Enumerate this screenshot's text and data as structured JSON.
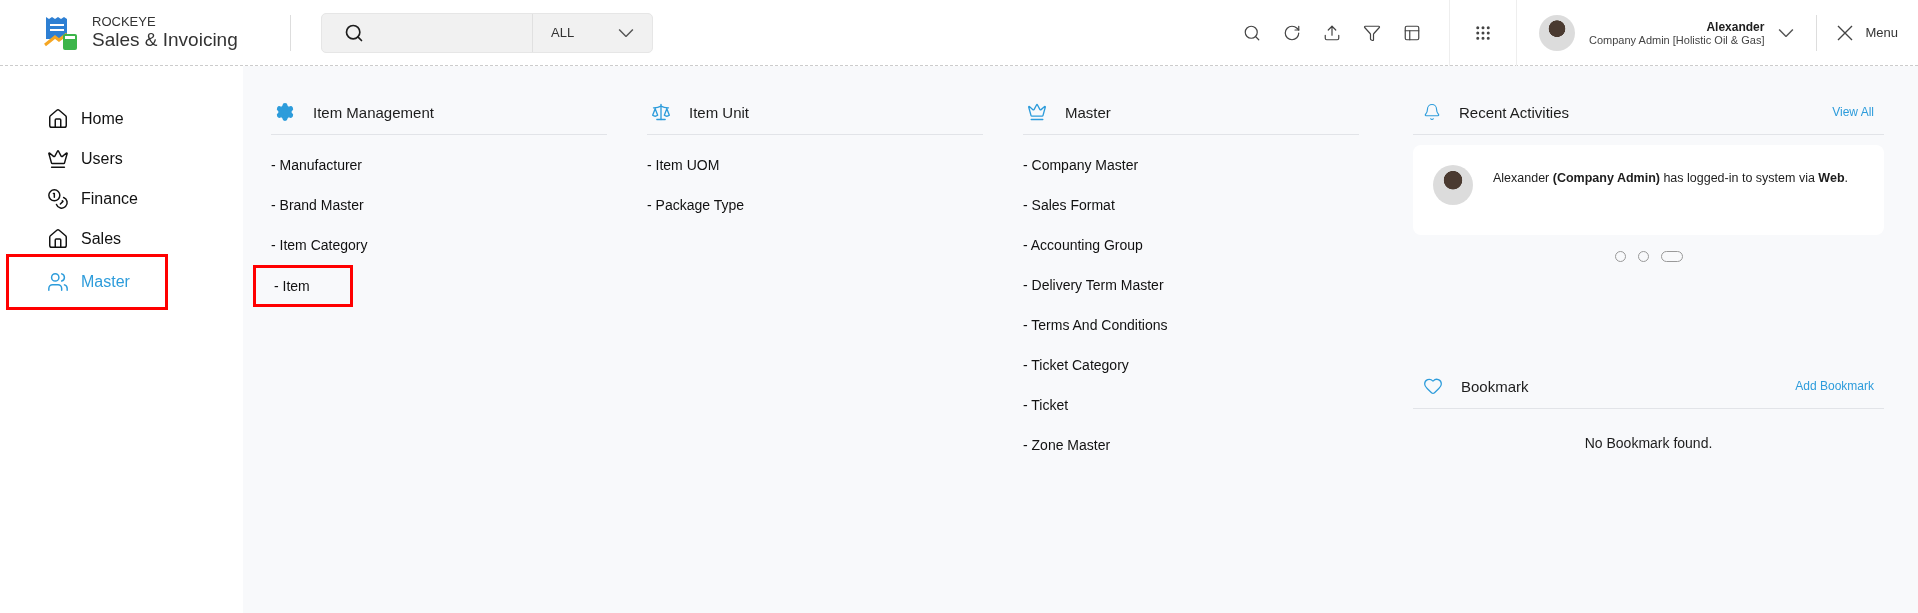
{
  "brand": {
    "company": "ROCKEYE",
    "product": "Sales & Invoicing"
  },
  "search": {
    "scope": "ALL"
  },
  "user": {
    "name": "Alexander",
    "role": "Company Admin [Holistic Oil & Gas]"
  },
  "menu_button": {
    "label": "Menu"
  },
  "sidebar": {
    "items": [
      {
        "label": "Home",
        "selected": false,
        "highlighted": false
      },
      {
        "label": "Users",
        "selected": false,
        "highlighted": false
      },
      {
        "label": "Finance",
        "selected": false,
        "highlighted": false
      },
      {
        "label": "Sales",
        "selected": false,
        "highlighted": false
      },
      {
        "label": "Master",
        "selected": true,
        "highlighted": true
      }
    ]
  },
  "sections": [
    {
      "title": "Item Management",
      "links": [
        {
          "label": "- Manufacturer",
          "highlighted": false
        },
        {
          "label": "- Brand Master",
          "highlighted": false
        },
        {
          "label": "- Item Category",
          "highlighted": false
        },
        {
          "label": "- Item",
          "highlighted": true
        }
      ]
    },
    {
      "title": "Item Unit",
      "links": [
        {
          "label": "- Item UOM",
          "highlighted": false
        },
        {
          "label": "- Package Type",
          "highlighted": false
        }
      ]
    },
    {
      "title": "Master",
      "links": [
        {
          "label": "- Company Master",
          "highlighted": false
        },
        {
          "label": "- Sales Format",
          "highlighted": false
        },
        {
          "label": "- Accounting Group",
          "highlighted": false
        },
        {
          "label": "- Delivery Term Master",
          "highlighted": false
        },
        {
          "label": "- Terms And Conditions",
          "highlighted": false
        },
        {
          "label": "- Ticket Category",
          "highlighted": false
        },
        {
          "label": "- Ticket",
          "highlighted": false
        },
        {
          "label": "- Zone Master",
          "highlighted": false
        }
      ]
    }
  ],
  "recent_activities": {
    "title": "Recent Activities",
    "action": "View All",
    "items": [
      {
        "text": "Alexander **(Company Admin)** has logged-in to system via **Web**."
      }
    ],
    "pages": [
      {
        "selected": false
      },
      {
        "selected": false
      },
      {
        "selected": true
      }
    ]
  },
  "bookmark": {
    "title": "Bookmark",
    "action": "Add Bookmark",
    "empty": "No Bookmark found."
  }
}
